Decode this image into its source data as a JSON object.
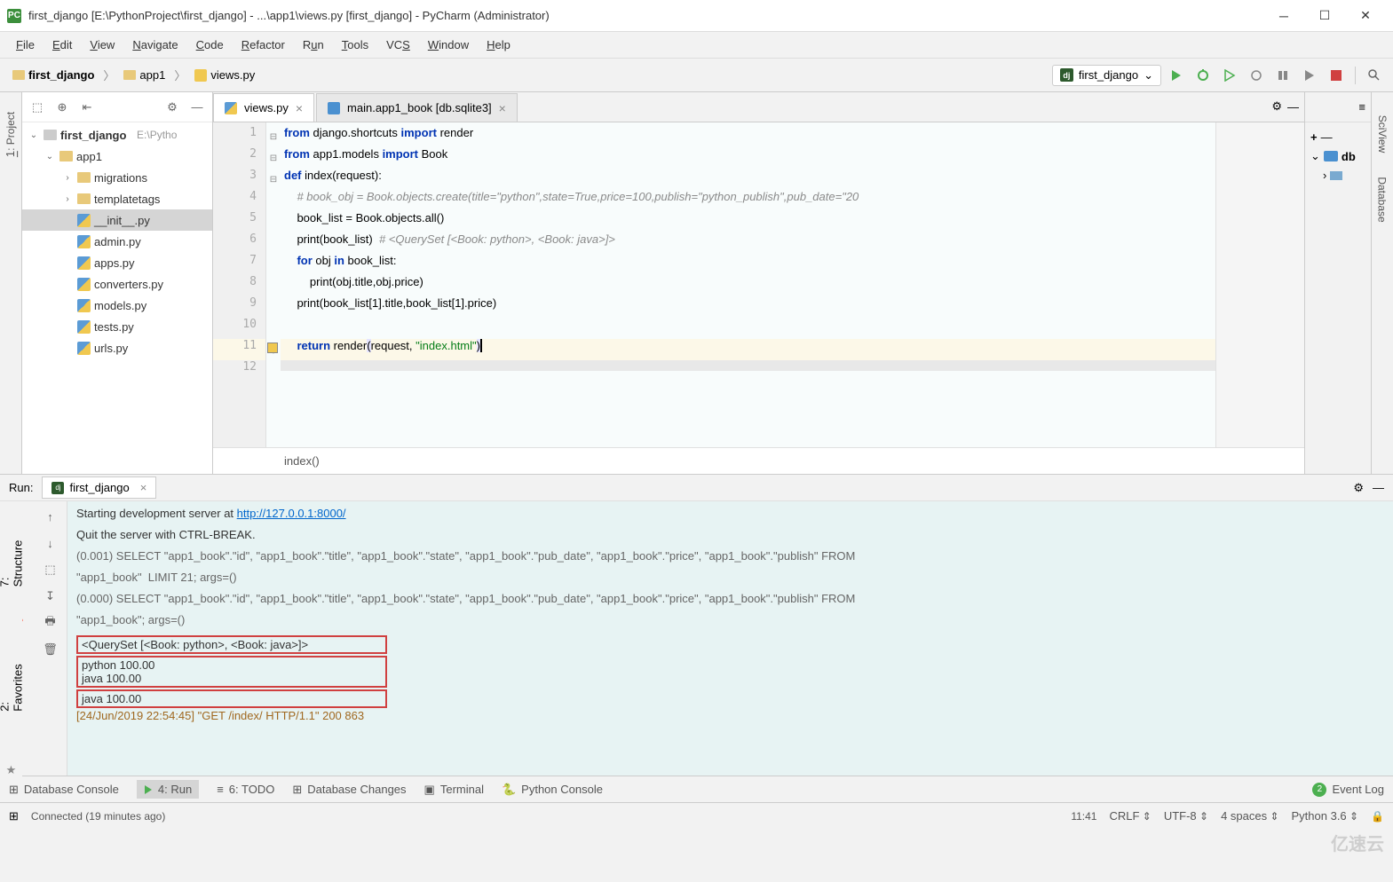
{
  "title": "first_django [E:\\PythonProject\\first_django] - ...\\app1\\views.py [first_django] - PyCharm (Administrator)",
  "menu": [
    "File",
    "Edit",
    "View",
    "Navigate",
    "Code",
    "Refactor",
    "Run",
    "Tools",
    "VCS",
    "Window",
    "Help"
  ],
  "breadcrumb": [
    "first_django",
    "app1",
    "views.py"
  ],
  "run_config": "first_django",
  "project_tree": {
    "root": {
      "name": "first_django",
      "path": "E:\\Pytho"
    },
    "app1": "app1",
    "migrations": "migrations",
    "templatetags": "templatetags",
    "files": [
      "__init__.py",
      "admin.py",
      "apps.py",
      "converters.py",
      "models.py",
      "tests.py",
      "urls.py"
    ]
  },
  "tabs": [
    {
      "name": "views.py"
    },
    {
      "name": "main.app1_book [db.sqlite3]"
    }
  ],
  "code_breadcrumb": "index()",
  "run": {
    "label": "Run:",
    "tab": "first_django",
    "console_lines": [
      "Starting development server at ",
      "http://127.0.0.1:8000/",
      "Quit the server with CTRL-BREAK.",
      "(0.001) SELECT \"app1_book\".\"id\", \"app1_book\".\"title\", \"app1_book\".\"state\", \"app1_book\".\"pub_date\", \"app1_book\".\"price\", \"app1_book\".\"publish\" FROM ",
      "\"app1_book\"  LIMIT 21; args=()",
      "(0.000) SELECT \"app1_book\".\"id\", \"app1_book\".\"title\", \"app1_book\".\"state\", \"app1_book\".\"pub_date\", \"app1_book\".\"price\", \"app1_book\".\"publish\" FROM ",
      "\"app1_book\"; args=()",
      "<QuerySet [<Book: python>, <Book: java>]>",
      "python 100.00",
      "java 100.00",
      "java 100.00",
      "[24/Jun/2019 22:54:45] \"GET /index/ HTTP/1.1\" 200 863"
    ]
  },
  "bottom_tabs": [
    "Database Console",
    "4: Run",
    "6: TODO",
    "Database Changes",
    "Terminal",
    "Python Console"
  ],
  "event_log": "Event Log",
  "event_count": "2",
  "status": {
    "connected": "Connected (19 minutes ago)",
    "pos": "11:41",
    "crlf": "CRLF",
    "enc": "UTF-8",
    "indent": "4 spaces",
    "python": "Python 3.6"
  },
  "watermark": "亿速云",
  "right_panel": {
    "plus": "+",
    "db": "db"
  },
  "left_tabs": [
    "1: Project"
  ],
  "left_bottom_tabs": [
    "7: Structure",
    "2: Favorites"
  ],
  "right_tabs": [
    "SciView",
    "Database"
  ]
}
